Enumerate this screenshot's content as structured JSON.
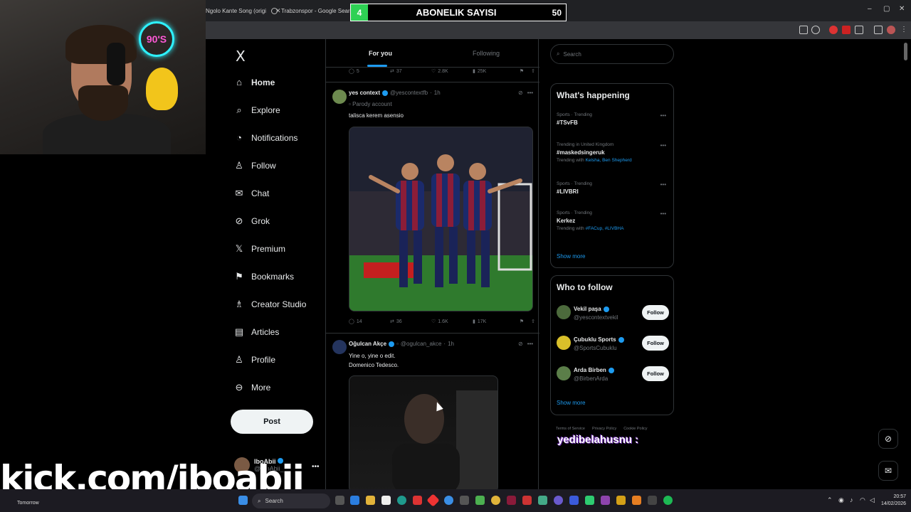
{
  "browser": {
    "tabs": [
      {
        "label": "Ngolo Kante Song (origi"
      },
      {
        "label": "Trabzonspor - Google Search"
      }
    ],
    "window_controls": [
      "–",
      "▢",
      "✕"
    ]
  },
  "subscriber_overlay": {
    "count": "4",
    "label": "ABONELIK SAYISI",
    "goal": "50",
    "accent": "#2ed154"
  },
  "webcam": {
    "neon_text": "90'S"
  },
  "kick_overlay": "kick.com/iboabii",
  "x": {
    "logo": "X",
    "nav": [
      {
        "label": "Home",
        "icon": "home-icon"
      },
      {
        "label": "Explore",
        "icon": "search-icon"
      },
      {
        "label": "Notifications",
        "icon": "bell-icon"
      },
      {
        "label": "Follow",
        "icon": "add-person-icon"
      },
      {
        "label": "Chat",
        "icon": "mail-icon"
      },
      {
        "label": "Grok",
        "icon": "grok-icon"
      },
      {
        "label": "Premium",
        "icon": "x-icon"
      },
      {
        "label": "Bookmarks",
        "icon": "bookmark-icon"
      },
      {
        "label": "Creator Studio",
        "icon": "creator-icon"
      },
      {
        "label": "Articles",
        "icon": "article-icon"
      },
      {
        "label": "Profile",
        "icon": "person-icon"
      },
      {
        "label": "More",
        "icon": "more-circle-icon"
      }
    ],
    "post_button": "Post",
    "profile": {
      "name": "IboAbii",
      "handle": "@IboAbii_"
    },
    "timeline": {
      "tabs": [
        "For you",
        "Following"
      ],
      "top_actions": {
        "replies": "5",
        "reposts": "37",
        "likes": "2.8K",
        "views": "25K"
      },
      "tweets": [
        {
          "name": "yes context",
          "handle": "@yescontextfb",
          "time": "1h",
          "sub": "Parody account",
          "text": "taliscа kerem asensio",
          "actions": {
            "replies": "14",
            "reposts": "36",
            "likes": "1.6K",
            "views": "17K"
          }
        },
        {
          "name": "Oğulcan Akçe",
          "handle": "@ogulcan_akce",
          "time": "1h",
          "text_lines": [
            "Yine o, yine o edit.",
            "Domenico Tedesco."
          ]
        }
      ]
    },
    "search_placeholder": "Search",
    "whats_happening": {
      "title": "What's happening",
      "trends": [
        {
          "context": "Sports · Trending",
          "title": "#TSvFB"
        },
        {
          "context": "Trending in United Kingdom",
          "title": "#maskedsingeruk",
          "with": "Kelsha, Ben Shepherd"
        },
        {
          "context": "Sports · Trending",
          "title": "#LIVBRI"
        },
        {
          "context": "Sports · Trending",
          "title": "Kerkez",
          "with": "#FACup, #LIVBHA"
        }
      ],
      "show_more": "Show more"
    },
    "who_to_follow": {
      "title": "Who to follow",
      "accounts": [
        {
          "name": "Vekil paşa",
          "handle": "@yescontextvekil",
          "button": "Follow"
        },
        {
          "name": "Çubuklu Sports",
          "handle": "@SportsCubuklu",
          "button": "Follow"
        },
        {
          "name": "Arda Birben",
          "handle": "@BirbenArda",
          "button": "Follow"
        }
      ],
      "show_more": "Show more"
    },
    "footer_links": [
      "Terms of Service",
      "Privacy Policy",
      "Cookie Policy"
    ],
    "chat_overlay": "yedibelahusnu :"
  },
  "taskbar": {
    "weather": "Tomorrow",
    "search": "Search",
    "time": "20:57",
    "date": "14/02/2026"
  }
}
